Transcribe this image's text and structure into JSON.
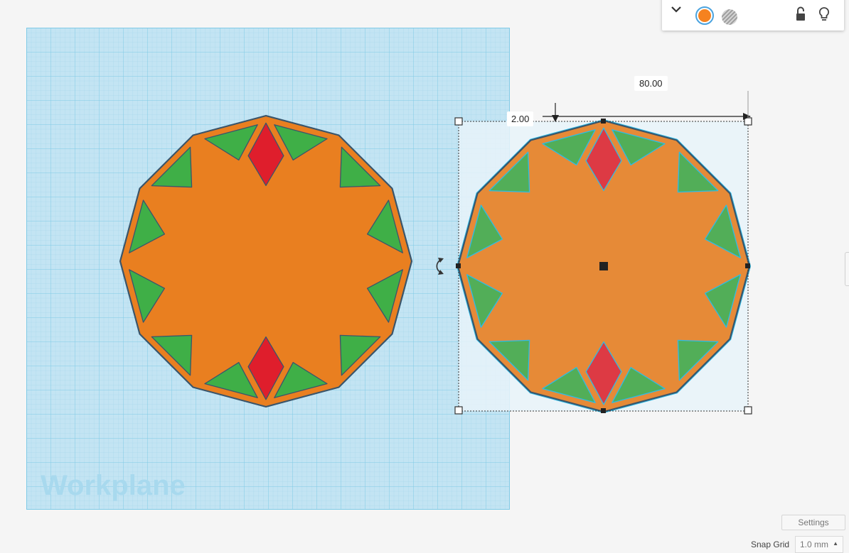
{
  "workplane": {
    "label": "Workplane"
  },
  "dimensions": {
    "width_value": "80.00",
    "offset_value": "2.00"
  },
  "shape_panel": {
    "solid_color": "#f5821f",
    "hole_icon": "hole-striped-icon",
    "collapse_icon": "chevron-down-icon",
    "lock_icon": "unlock-icon",
    "light_icon": "lightbulb-icon"
  },
  "settings": {
    "label": "Settings"
  },
  "snap_grid": {
    "label": "Snap Grid",
    "value": "1.0 mm"
  },
  "colors": {
    "base": "#e97f20",
    "base_selected": "#e68a37",
    "triangle": "#3faf47",
    "triangle_selected": "#52ae58",
    "diamond": "#df1e2c",
    "diamond_selected": "#dd3a44",
    "outline": "#3a556b",
    "selection_outline": "#2dbce8",
    "grid_bg": "#c3e4f3",
    "grid_major": "#7fcae6",
    "workplane_text": "#a8d9ee"
  }
}
